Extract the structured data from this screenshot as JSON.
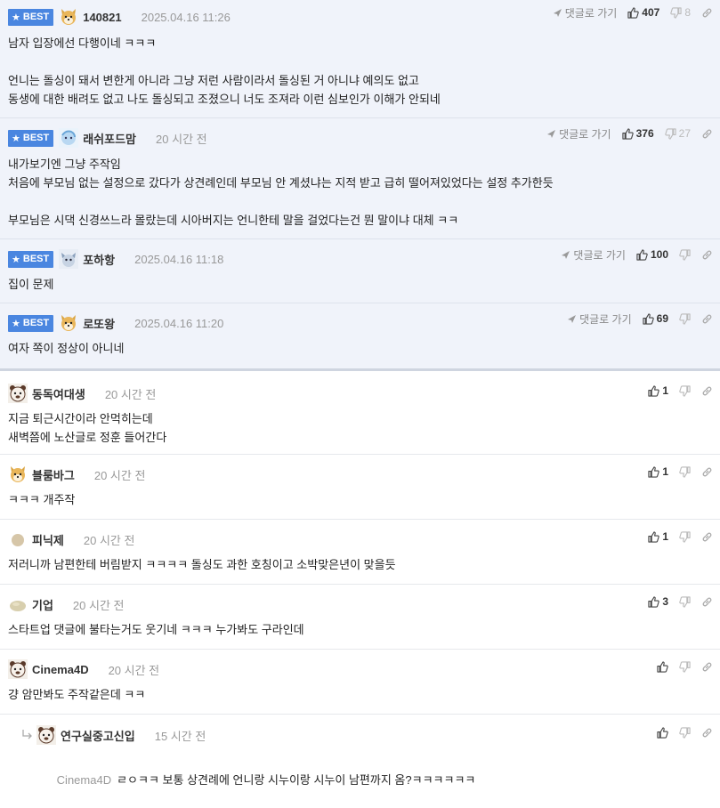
{
  "labels": {
    "best": "BEST",
    "reply_link": "댓글로 가기"
  },
  "colors": {
    "best_badge": "#4a86e0",
    "best_row_bg": "#f0f3fa",
    "time_text": "#999999"
  },
  "best_comments": [
    {
      "avatar": "shiba-dog",
      "nick": "140821",
      "time": "2025.04.16 11:26",
      "up": "407",
      "down": "8",
      "body": "남자 입장에선 다행이네 ㅋㅋㅋ\n\n언니는 돌싱이 돼서 변한게 아니라 그냥 저런 사람이라서 돌싱된 거 아니냐 예의도 없고\n동생에 대한 배려도 없고 나도 돌싱되고 조졌으니 너도 조져라 이런 심보인가 이해가 안되네"
    },
    {
      "avatar": "blue-creature",
      "nick": "래쉬포드맘",
      "time": "20 시간 전",
      "up": "376",
      "down": "27",
      "body": "내가보기엔 그냥 주작임\n처음에 부모님 없는 설정으로 갔다가 상견례인데 부모님 안 계셨냐는 지적 받고 급히 떨어져있었다는 설정 추가한듯\n\n부모님은 시댁 신경쓰느라 몰랐는데 시아버지는 언니한테 말을 걸었다는건 뭔 말이냐 대체 ㅋㅋ"
    },
    {
      "avatar": "cat-face",
      "nick": "포하항",
      "time": "2025.04.16 11:18",
      "up": "100",
      "down": "",
      "body": "집이 문제"
    },
    {
      "avatar": "shiba-dog",
      "nick": "로또왕",
      "time": "2025.04.16 11:20",
      "up": "69",
      "down": "",
      "body": "여자 쪽이 정상이 아니네"
    }
  ],
  "comments": [
    {
      "avatar": "bear-face",
      "nick": "동독여대생",
      "time": "20 시간 전",
      "up": "1",
      "body": "지금 퇴근시간이라 안먹히는데\n새벽쯤에 노산글로 정훈 들어간다"
    },
    {
      "avatar": "shiba-dog",
      "nick": "블룸바그",
      "time": "20 시간 전",
      "up": "1",
      "body": "ㅋㅋㅋ 개주작"
    },
    {
      "avatar": "beige-dot",
      "nick": "피닉제",
      "time": "20 시간 전",
      "up": "1",
      "body": "저러니까 남편한테 버림받지 ㅋㅋㅋㅋ 돌싱도 과한 호칭이고 소박맞은년이 맞을듯"
    },
    {
      "avatar": "beige-blob",
      "nick": "기업",
      "time": "20 시간 전",
      "up": "3",
      "body": "스타트업 댓글에 불타는거도 웃기네 ㅋㅋㅋ 누가봐도 구라인데"
    },
    {
      "avatar": "bear-face",
      "nick": "Cinema4D",
      "time": "20 시간 전",
      "up": "",
      "body": "걍 암만봐도 주작같은데 ㅋㅋ"
    }
  ],
  "reply": {
    "avatar": "bear-face",
    "nick": "연구실중고신입",
    "time": "15 시간 전",
    "mention": "Cinema4D",
    "body": "ㄹㅇㅋㅋ 보통 상견례에 언니랑 시누이랑 시누이 남편까지 옴?ㅋㅋㅋㅋㅋㅋ"
  }
}
